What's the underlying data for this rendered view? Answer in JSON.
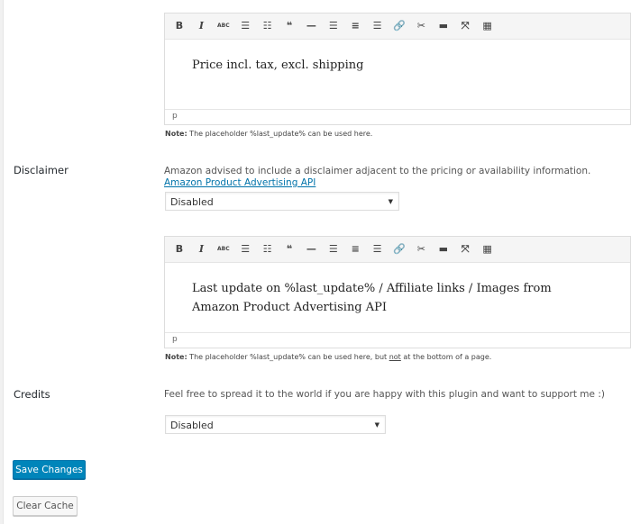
{
  "editor_toolbar": [
    {
      "icon": "bold-icon",
      "glyph": "B"
    },
    {
      "icon": "italic-icon",
      "glyph": "I"
    },
    {
      "icon": "strikethrough-icon",
      "glyph": "ABC"
    },
    {
      "icon": "bullet-list-icon",
      "glyph": "☰"
    },
    {
      "icon": "numbered-list-icon",
      "glyph": "☷"
    },
    {
      "icon": "blockquote-icon",
      "glyph": "❝"
    },
    {
      "icon": "horizontal-rule-icon",
      "glyph": "—"
    },
    {
      "icon": "align-left-icon",
      "glyph": "☰"
    },
    {
      "icon": "align-center-icon",
      "glyph": "≡"
    },
    {
      "icon": "align-right-icon",
      "glyph": "☰"
    },
    {
      "icon": "link-icon",
      "glyph": "🔗"
    },
    {
      "icon": "unlink-icon",
      "glyph": "✂"
    },
    {
      "icon": "read-more-icon",
      "glyph": "▬"
    },
    {
      "icon": "fullscreen-icon",
      "glyph": "⤧"
    },
    {
      "icon": "toolbar-toggle-icon",
      "glyph": "▦"
    }
  ],
  "price_editor": {
    "content": "Price incl. tax, excl. shipping",
    "path": "p",
    "note_label": "Note:",
    "note": " The placeholder %last_update% can be used here."
  },
  "disclaimer": {
    "label": "Disclaimer",
    "description": "Amazon advised to include a disclaimer adjacent to the pricing or availability information. ",
    "link": "Amazon Product Advertising API",
    "select_value": "Disabled",
    "editor_content": "Last update on %last_update% / Affiliate links / Images from Amazon Product Advertising API",
    "path": "p",
    "note_label": "Note:",
    "note_a": " The placeholder %last_update% can be used here, but ",
    "note_b": "not",
    "note_c": " at the bottom of a page."
  },
  "credits": {
    "label": "Credits",
    "description": "Feel free to spread it to the world if you are happy with this plugin and want to support me :)",
    "select_value": "Disabled"
  },
  "buttons": {
    "save": "Save Changes",
    "clear_cache": "Clear Cache"
  }
}
